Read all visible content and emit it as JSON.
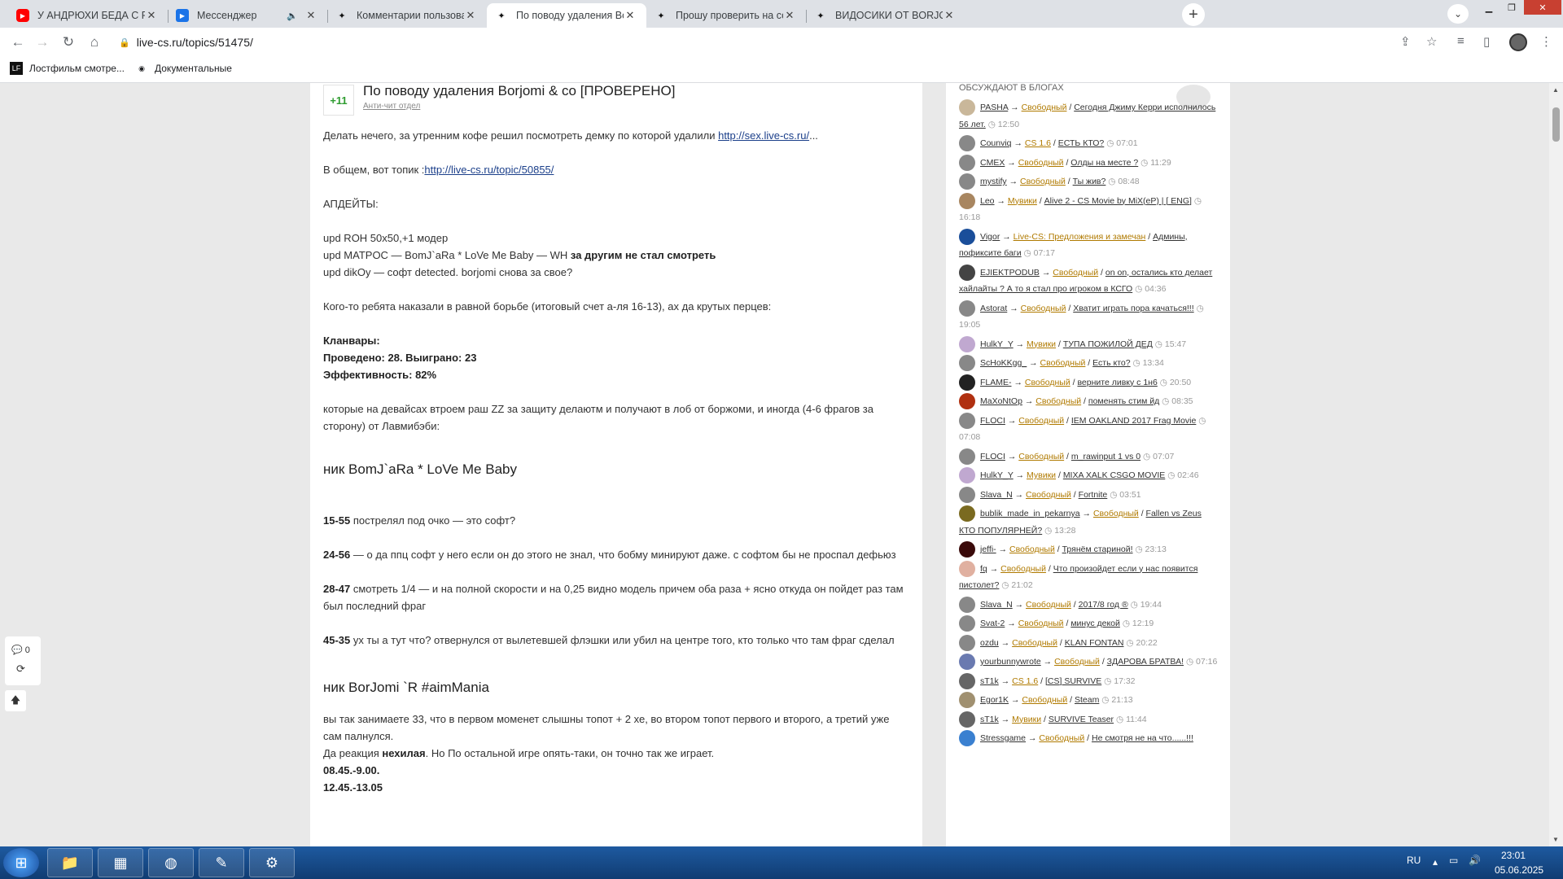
{
  "tabs": [
    {
      "label": "У АНДРЮХИ БЕДА С РУКОЙ / П",
      "icon": "youtube-icon",
      "color": "#ff0000"
    },
    {
      "label": "Мессенджер",
      "icon": "messenger-icon",
      "color": "#1a73e8",
      "muted": "🔈"
    },
    {
      "label": "Комментарии пользователя Bor",
      "icon": "livecs-icon"
    },
    {
      "label": "По поводу удаления Borjomi &",
      "icon": "livecs-icon",
      "active": true
    },
    {
      "label": "Прошу проверить на софт ребя",
      "icon": "livecs-icon"
    },
    {
      "label": "ВИДОСИКИ ОТ BORJOMI | Стра",
      "icon": "livecs-icon"
    }
  ],
  "address": {
    "url": "live-cs.ru/topics/51475/"
  },
  "bookmarks": [
    {
      "label": "Лостфильм смотре...",
      "icon": "lostfilm-icon",
      "glyph": "LF"
    },
    {
      "label": "Документальные",
      "icon": "globe-icon",
      "glyph": "◉"
    }
  ],
  "post": {
    "votes": "+11",
    "title": "По поводу удаления Borjomi & co [ПРОВЕРЕНО]",
    "category": "Анти-чит отдел",
    "p1": "Делать нечего, за утренним кофе решил посмотреть демку по которой удалили ",
    "p1_link": "http://sex.live-cs.ru/",
    "p1_tail": "...",
    "p2": "В общем, вот топик :",
    "p2_link": "http://live-cs.ru/topic/50855/",
    "upd_header": "АПДЕЙТЫ:",
    "upd1": "upd ROH 50x50,+1 модер",
    "upd2": "upd MATPOC — BomJ`aRa * LoVe Me Baby — WH ",
    "upd2_bold": "за другим не стал смотреть",
    "upd3": "upd dikOy — софт detected. borjomi снова за свое?",
    "p3": "Кого-то ребята наказали в равной борьбе (итоговый счет а-ля 16-13), ах да крутых перцев:",
    "stats1": "Кланвары:",
    "stats2": "Проведено: 28. Выиграно: 23",
    "stats3": "Эффективность: 82%",
    "p4": "которые на девайсах втроем раш ZZ за защиту делаютм и получают в лоб от боржоми, и иногда (4-6 фрагов за сторону) от Лавмибэби:",
    "h1": "ник BomJ`aRa * LoVe Me Baby",
    "t1": "15-55",
    "t1_text": " пострелял под очко — это софт?",
    "t2": "24-56",
    "t2_text": " — о да ппц софт у него если он до этого не знал, что бобму минируют даже. с софтом бы не проспал дефьюз",
    "t3": "28-47",
    "t3_text": " смотреть 1/4 — и на полной скорости и на 0,25 видно модель причем оба раза + ясно откуда он пойдет раз там был последний фраг",
    "t4": "45-35",
    "t4_text": " ух ты а тут что? отвернулся от вылетевшей флэшки или убил на центре того, кто только что там фраг сделал",
    "h2": "ник BorJomi `R #aimMania",
    "p5": "вы так занимаете 33, что в первом моменет слышны топот + 2 хе, во втором топот первого и второго, а третий уже сам палнулся.",
    "p6a": "Да реакция ",
    "p6b": "нехилая",
    "p6c": ". Но По остальной игре опять-таки, он точно так же играет.",
    "t5": "08.45.-9.00.",
    "t6": "12.45.-13.05"
  },
  "sidebar": {
    "title": "ОБСУЖДАЮТ В БЛОГАХ",
    "items": [
      {
        "user": "PASHA",
        "cat": "Свободный",
        "post": "Сегодня Джиму Керри исполнилось 56 лет.",
        "time": "12:50",
        "color": "#c9b79a"
      },
      {
        "user": "Counviq",
        "cat": "CS 1.6",
        "post": "ЕСТЬ КТО?",
        "time": "07:01",
        "color": "#888"
      },
      {
        "user": "CMEX",
        "cat": "Свободный",
        "post": "Олды на месте ?",
        "time": "11:29",
        "color": "#888"
      },
      {
        "user": "mystify",
        "cat": "Свободный",
        "post": "Ты жив?",
        "time": "08:48",
        "color": "#888"
      },
      {
        "user": "Leo",
        "cat": "Мувики",
        "post": "Alive 2 - CS Movie by MiX(eP) | [ ENG]",
        "time": "16:18",
        "color": "#a88660"
      },
      {
        "user": "Vigor",
        "cat": "Live-CS: Предложения и замечан",
        "post": "Админы, пофиксите баги",
        "time": "07:17",
        "color": "#1a4e9a"
      },
      {
        "user": "EJIEKTPODUB",
        "cat": "Свободный",
        "post": "on on, остались кто делает хайлайты ? А то я стал про игроком в КСГО",
        "time": "04:36",
        "color": "#444"
      },
      {
        "user": "Astorat",
        "cat": "Свободный",
        "post": "Хватит играть пора качаться!!!",
        "time": "19:05",
        "color": "#888"
      },
      {
        "user": "HulkY_Y",
        "cat": "Мувики",
        "post": "ТУПА ПОЖИЛОЙ ДЕД",
        "time": "15:47",
        "color": "#c0a8d0"
      },
      {
        "user": "ScHoKKgg_",
        "cat": "Свободный",
        "post": "Есть кто?",
        "time": "13:34",
        "color": "#888"
      },
      {
        "user": "FLAME-",
        "cat": "Свободный",
        "post": "верните ливку с 1н6",
        "time": "20:50",
        "color": "#222"
      },
      {
        "user": "MaXoNtOp",
        "cat": "Свободный",
        "post": "поменять стим йд",
        "time": "08:35",
        "color": "#b03010"
      },
      {
        "user": "FLOCI",
        "cat": "Свободный",
        "post": "IEM OAKLAND 2017 Frag Movie",
        "time": "07:08",
        "color": "#888"
      },
      {
        "user": "FLOCI",
        "cat": "Свободный",
        "post": "m_rawinput 1 vs 0",
        "time": "07:07",
        "color": "#888"
      },
      {
        "user": "HulkY_Y",
        "cat": "Мувики",
        "post": "MIXA XALK CSGO MOVIE",
        "time": "02:46",
        "color": "#c0a8d0"
      },
      {
        "user": "Slava_N",
        "cat": "Свободный",
        "post": "Fortnite",
        "time": "03:51",
        "color": "#888"
      },
      {
        "user": "bublik_made_in_pekarnya",
        "cat": "Свободный",
        "post": "Fallen vs Zeus КТО ПОПУЛЯРНЕЙ?",
        "time": "13:28",
        "color": "#7a6a20"
      },
      {
        "user": "jeffi-",
        "cat": "Свободный",
        "post": "Трянём стариной!",
        "time": "23:13",
        "color": "#3a0a0a"
      },
      {
        "user": "fq",
        "cat": "Свободный",
        "post": "Что произойдет если у нас появится пистолет?",
        "time": "21:02",
        "color": "#e0b0a0"
      },
      {
        "user": "Slava_N",
        "cat": "Свободный",
        "post": "2017/8 год ®",
        "time": "19:44",
        "color": "#888"
      },
      {
        "user": "Svat-2",
        "cat": "Свободный",
        "post": "минус декой",
        "time": "12:19",
        "color": "#888"
      },
      {
        "user": "ozdu",
        "cat": "Свободный",
        "post": "KLAN FONTAN",
        "time": "20:22",
        "color": "#888"
      },
      {
        "user": "yourbunnywrote",
        "cat": "Свободный",
        "post": "ЗДАРОВА БРАТВА!",
        "time": "07:16",
        "color": "#6a7ab0"
      },
      {
        "user": "sT1k",
        "cat": "CS 1.6",
        "post": "[CS] SURVIVE",
        "time": "17:32",
        "color": "#666"
      },
      {
        "user": "Egor1K",
        "cat": "Свободный",
        "post": "Steam",
        "time": "21:13",
        "color": "#a09070"
      },
      {
        "user": "sT1k",
        "cat": "Мувики",
        "post": "SURVIVE Teaser",
        "time": "11:44",
        "color": "#666"
      },
      {
        "user": "Stressgame",
        "cat": "Свободный",
        "post": "Не смотря не на что......!!!",
        "time": "",
        "color": "#3a80d0"
      }
    ]
  },
  "widget": {
    "comments": "0"
  },
  "taskbar": {
    "lang": "RU",
    "time": "23:01",
    "date": "05.06.2025"
  }
}
